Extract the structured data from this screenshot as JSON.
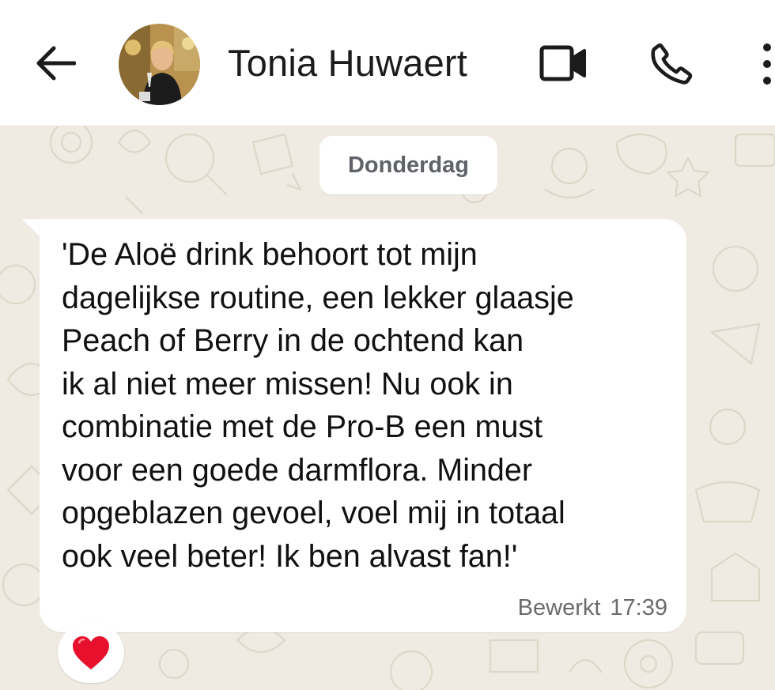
{
  "header": {
    "contact_name": "Tonia Huwaert",
    "back_icon": "arrow-left-icon",
    "video_icon": "video-camera-icon",
    "call_icon": "phone-icon",
    "menu_icon": "more-vertical-icon"
  },
  "chat": {
    "date_label": "Donderdag",
    "message": {
      "text": "'De Aloë drink behoort tot mijn\ndagelijkse routine, een lekker glaasje\nPeach of Berry in de ochtend kan\nik al niet meer missen! Nu ook in\ncombinatie met de Pro-B een must\nvoor een goede darmflora. Minder\nopgeblazen gevoel, voel mij in totaal\nook veel beter! Ik ben alvast fan!'",
      "status": "Bewerkt",
      "time": "17:39",
      "reaction_icon": "red-heart-icon"
    }
  },
  "colors": {
    "header_bg": "#ffffff",
    "chat_bg": "#efeae2",
    "bubble_bg": "#ffffff",
    "heart": "#e8112d"
  }
}
